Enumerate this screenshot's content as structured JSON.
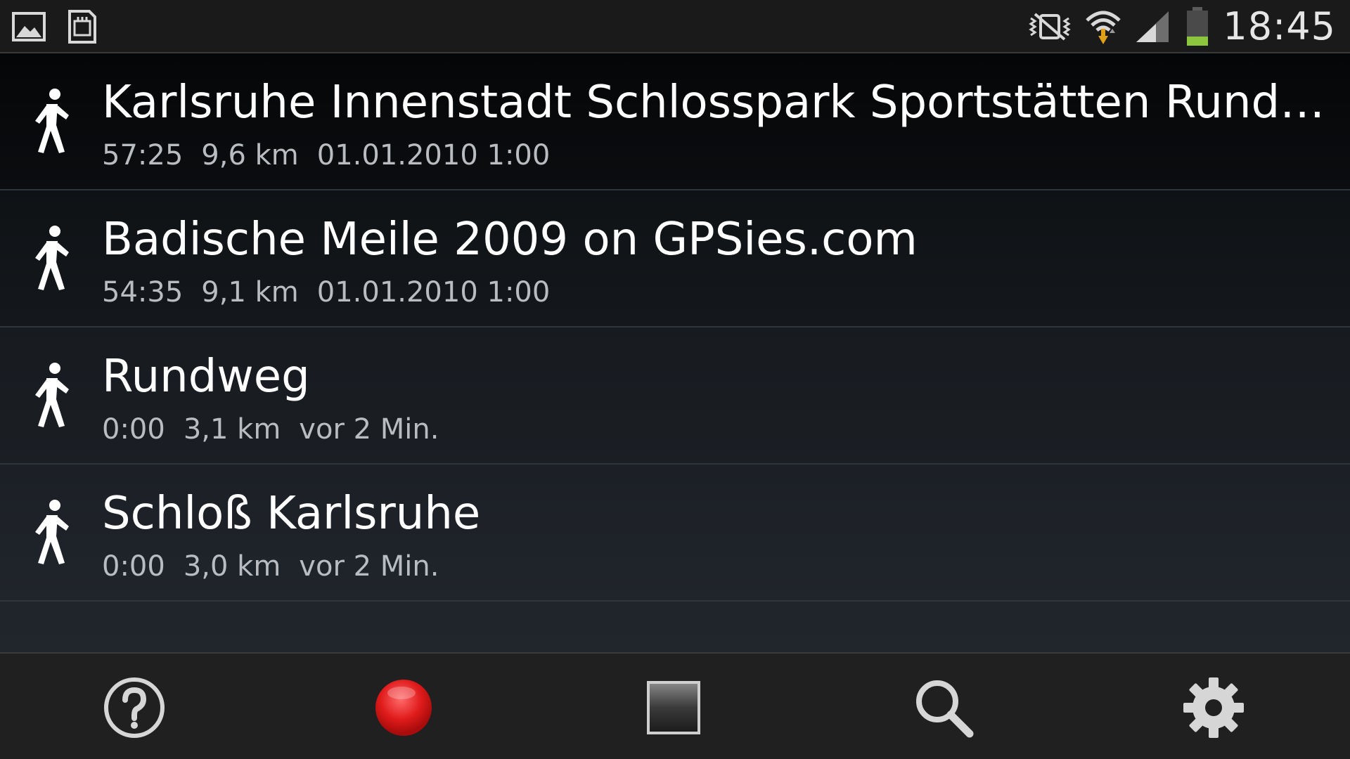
{
  "status_bar": {
    "time": "18:45",
    "left_icons": [
      "gallery-icon",
      "sd-card-icon"
    ],
    "right_icons": [
      "vibrate-mute-icon",
      "wifi-icon",
      "signal-icon",
      "battery-icon"
    ],
    "battery_color": "#8cc63f"
  },
  "tracks": [
    {
      "title": "Karlsruhe Innenstadt Schlosspark Sportstätten Runde on GPSies.com",
      "duration": "57:25",
      "distance": "9,6 km",
      "date": "01.01.2010 1:00",
      "icon": "walking-person-icon"
    },
    {
      "title": "Badische Meile 2009 on GPSies.com",
      "duration": "54:35",
      "distance": "9,1 km",
      "date": "01.01.2010 1:00",
      "icon": "walking-person-icon"
    },
    {
      "title": "Rundweg",
      "duration": "0:00",
      "distance": "3,1 km",
      "date": "vor 2 Min.",
      "icon": "walking-person-icon"
    },
    {
      "title": "Schloß Karlsruhe",
      "duration": "0:00",
      "distance": "3,0 km",
      "date": "vor 2 Min.",
      "icon": "walking-person-icon"
    }
  ],
  "actions": [
    {
      "name": "help",
      "icon": "help-icon"
    },
    {
      "name": "record",
      "icon": "record-icon",
      "color": "#e01b1b"
    },
    {
      "name": "stop",
      "icon": "stop-icon"
    },
    {
      "name": "search",
      "icon": "search-icon"
    },
    {
      "name": "settings",
      "icon": "gear-icon"
    }
  ]
}
